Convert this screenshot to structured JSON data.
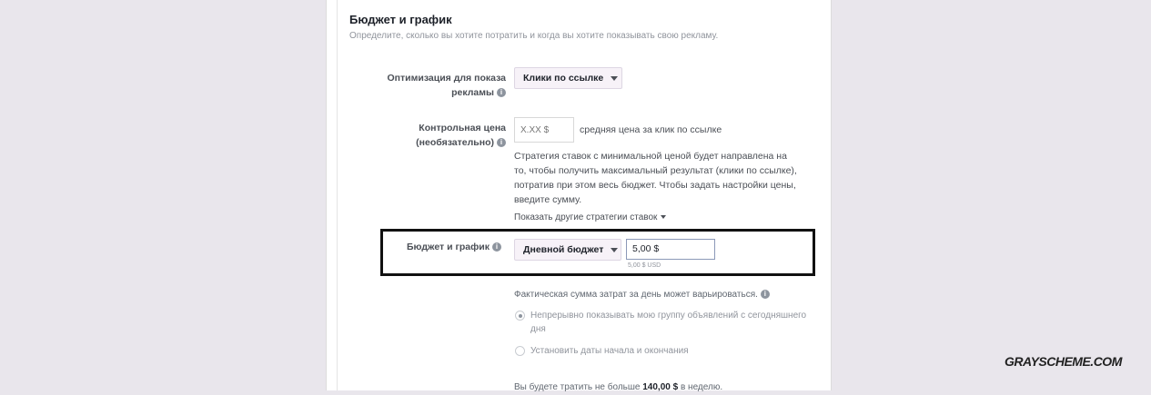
{
  "section": {
    "title": "Бюджет и график",
    "subtitle": "Определите, сколько вы хотите потратить и когда вы хотите показывать свою рекламу."
  },
  "optimization": {
    "label_line1": "Оптимизация для показа",
    "label_line2": "рекламы",
    "selected": "Клики по ссылке"
  },
  "control_price": {
    "label_line1": "Контрольная цена",
    "label_line2": "(необязательно)",
    "placeholder": "X.XX $",
    "suffix": "средняя цена за клик по ссылке",
    "description": [
      "Стратегия ставок с минимальной ценой будет направлена на",
      "то, чтобы получить максимальный результат (клики по ссылке),",
      "потратив при этом весь бюджет. Чтобы задать настройки цены,",
      "введите сумму."
    ],
    "more_strategies": "Показать другие стратегии ставок"
  },
  "budget": {
    "label": "Бюджет и график",
    "type": "Дневной бюджет",
    "value": "5,00 $",
    "hint": "5,00 $ USD"
  },
  "schedule": {
    "note": "Фактическая сумма затрат за день может варьироваться.",
    "option1_line1": "Непрерывно показывать мою группу объявлений с сегодняшнего",
    "option1_line2": "дня",
    "option2": "Установить даты начала и окончания",
    "weekly_prefix": "Вы будете тратить не больше",
    "weekly_amount": "140,00 $",
    "weekly_suffix": "в неделю."
  },
  "watermark": "GRAYSCHEME.COM",
  "icons": {
    "info": "info-icon",
    "caret": "caret-down-icon"
  },
  "colors": {
    "page_bg": "#e9e6ec",
    "panel_bg": "#ffffff",
    "dropdown_bg": "#f7f2f8",
    "highlight_border": "#111111"
  }
}
